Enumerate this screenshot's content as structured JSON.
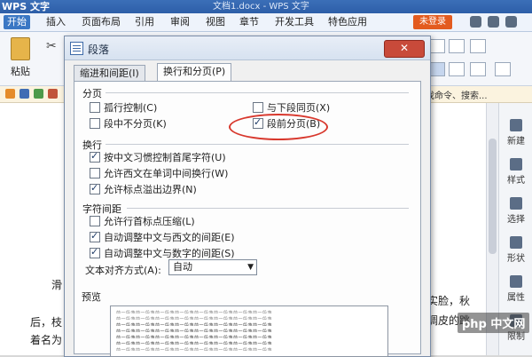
{
  "app": {
    "logo": "WPS 文字",
    "doc_title": "文档1.docx - WPS 文字"
  },
  "menu": {
    "items": [
      "开始",
      "插入",
      "页面布局",
      "引用",
      "审阅",
      "视图",
      "章节",
      "开发工具",
      "特色应用"
    ],
    "login": "未登录"
  },
  "ribbon": {
    "paste_label": "粘贴"
  },
  "quickbar": {
    "search": "找命令、搜索..."
  },
  "sidepanel": {
    "items": [
      "新建",
      "样式",
      "选择",
      "形状",
      "属性",
      "限制"
    ]
  },
  "document": {
    "line1_left": "滑",
    "line1_right": "实脸，秋",
    "line2_left": "后，枝",
    "line2_right": "调皮的跳",
    "line3_left": "着名为"
  },
  "watermark": "php 中文网",
  "dialog": {
    "title": "段落",
    "close_symbol": "✕",
    "tabs": [
      "缩进和间距(I)",
      "换行和分页(P)"
    ],
    "pagination": {
      "title": "分页",
      "options": [
        {
          "label": "孤行控制(C)",
          "checked": false
        },
        {
          "label": "与下段同页(X)",
          "checked": false
        },
        {
          "label": "段中不分页(K)",
          "checked": false
        },
        {
          "label": "段前分页(B)",
          "checked": true
        }
      ]
    },
    "line_break": {
      "title": "换行",
      "options": [
        {
          "label": "按中文习惯控制首尾字符(U)",
          "checked": true
        },
        {
          "label": "允许西文在单词中间换行(W)",
          "checked": false
        },
        {
          "label": "允许标点溢出边界(N)",
          "checked": true
        }
      ]
    },
    "char_spacing": {
      "title": "字符间距",
      "options": [
        {
          "label": "允许行首标点压缩(L)",
          "checked": false
        },
        {
          "label": "自动调整中文与西文的间距(E)",
          "checked": true
        },
        {
          "label": "自动调整中文与数字的间距(S)",
          "checked": true
        }
      ],
      "align_label": "文本对齐方式(A):",
      "align_value": "自动"
    },
    "preview": {
      "title": "预览",
      "sample": "前一段落前一段落前一段落前一段落前一段落前一段落前一段落前一段落"
    }
  }
}
